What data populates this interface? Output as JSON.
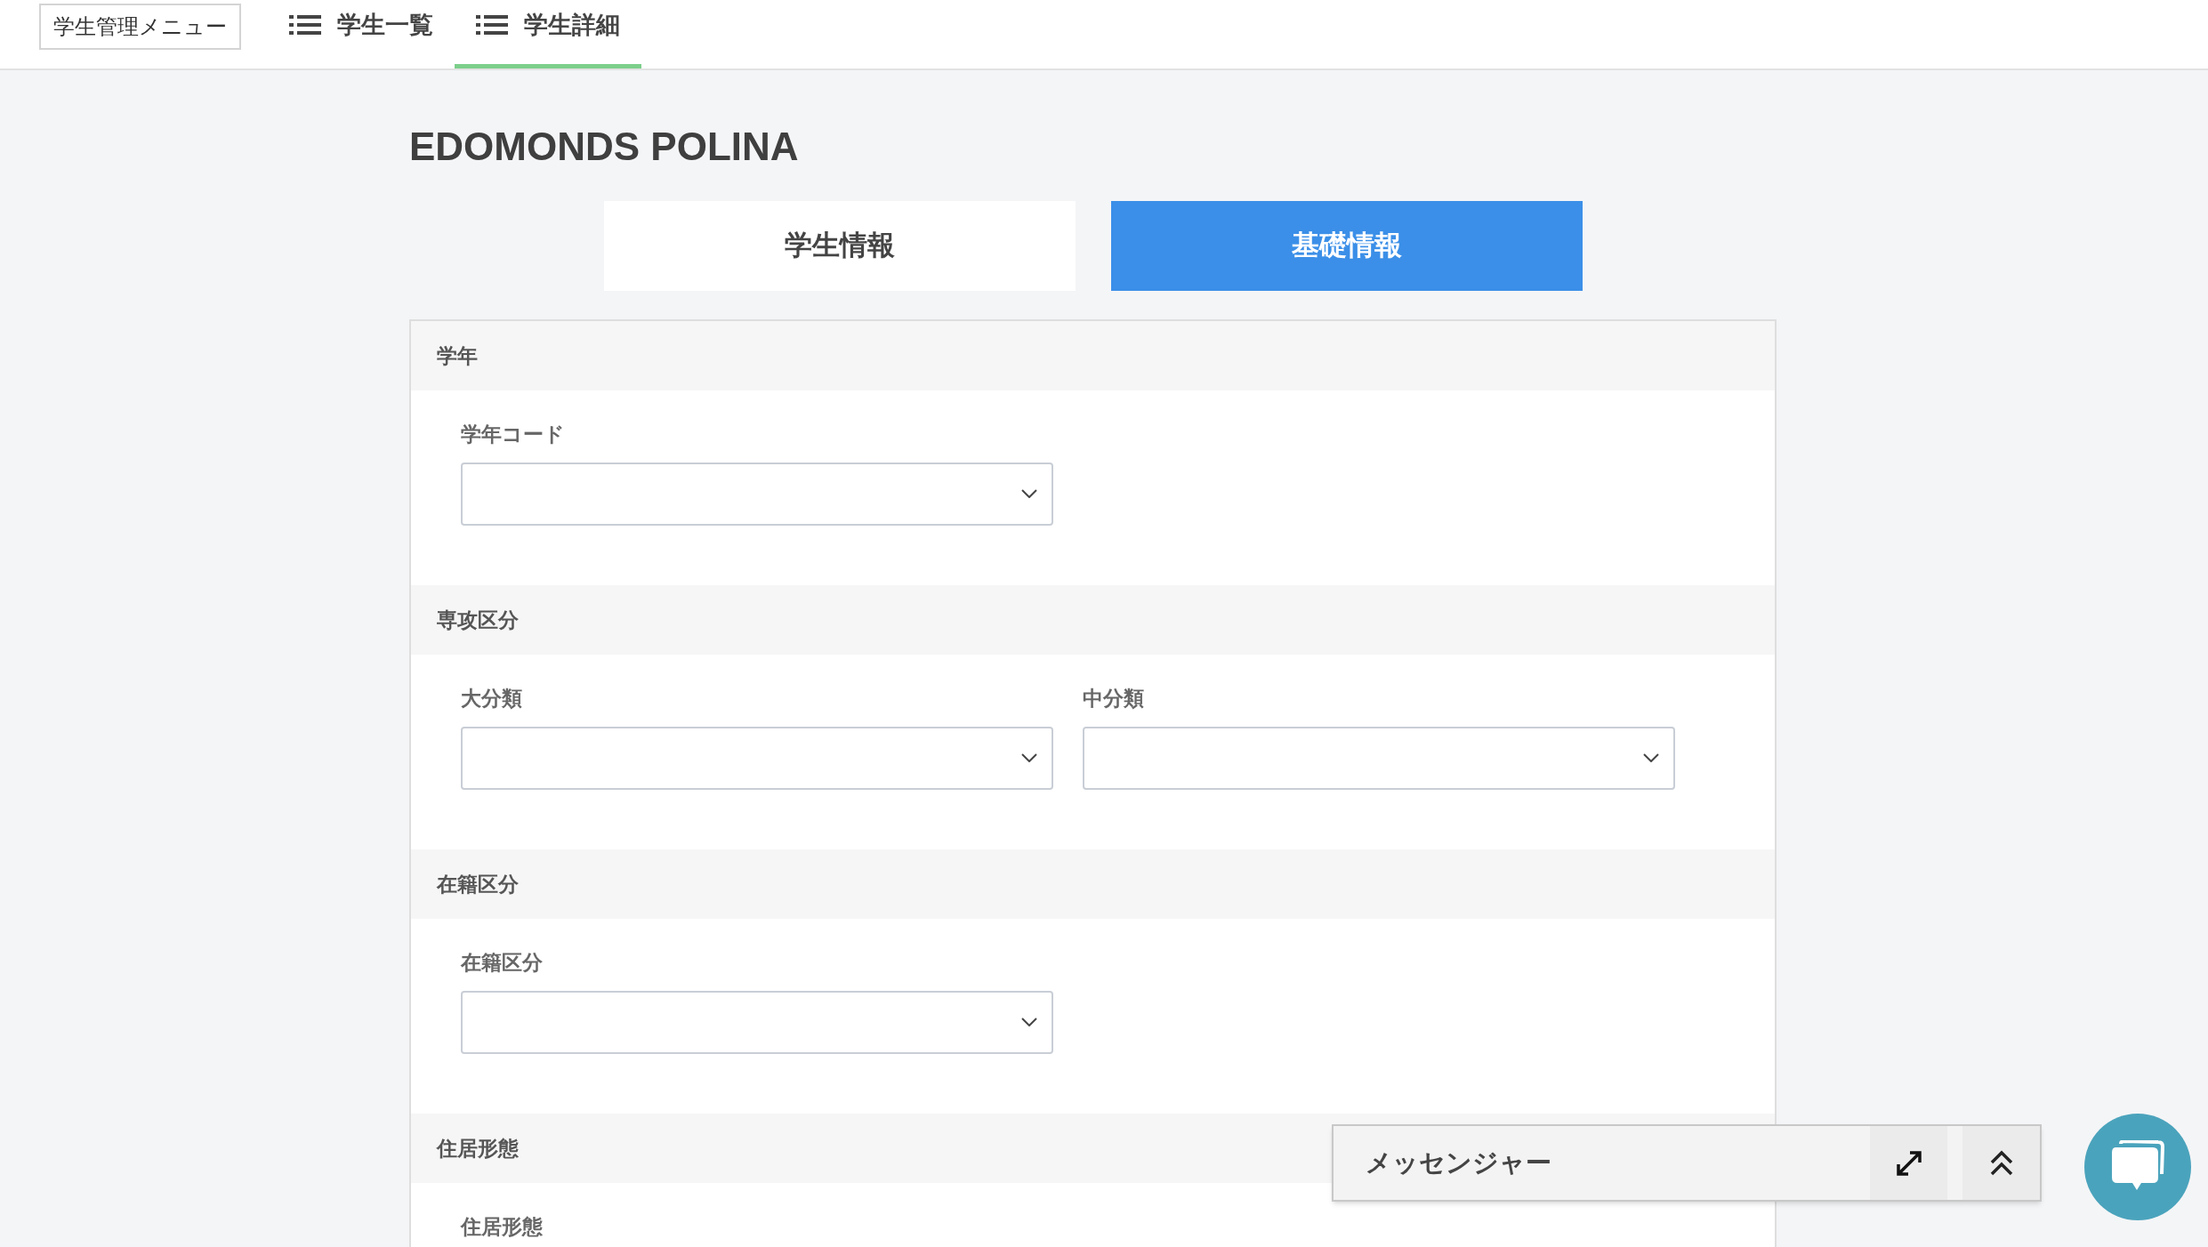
{
  "menu_button": "学生管理メニュー",
  "nav_tabs": [
    {
      "label": "学生一覧",
      "selected": false
    },
    {
      "label": "学生詳細",
      "selected": true
    }
  ],
  "title": "EDOMONDS POLINA",
  "view_tabs": [
    {
      "label": "学生情報",
      "selected": false
    },
    {
      "label": "基礎情報",
      "selected": true
    }
  ],
  "sections": [
    {
      "title": "学年",
      "fields": [
        {
          "label": "学年コード",
          "dropdown": true
        }
      ]
    },
    {
      "title": "専攻区分",
      "fields": [
        {
          "label": "大分類",
          "dropdown": true
        },
        {
          "label": "中分類",
          "dropdown": true
        }
      ]
    },
    {
      "title": "在籍区分",
      "fields": [
        {
          "label": "在籍区分",
          "dropdown": true
        }
      ]
    },
    {
      "title": "住居形態",
      "fields": [
        {
          "label": "住居形態",
          "dropdown": false
        }
      ]
    }
  ],
  "messenger": {
    "title": "メッセンジャー"
  }
}
